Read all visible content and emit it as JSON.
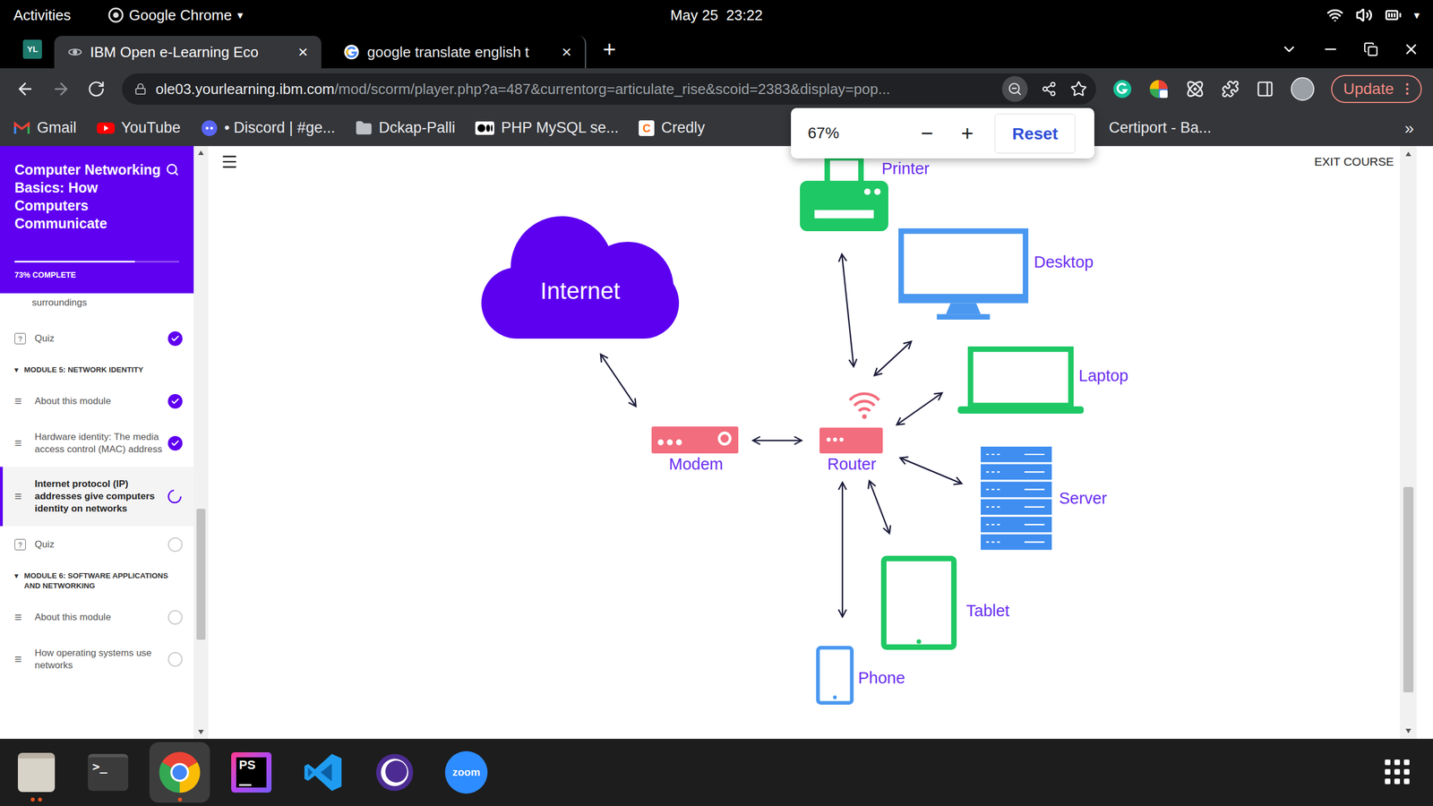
{
  "system_bar": {
    "activities": "Activities",
    "app": "Google Chrome",
    "app_menu": "▾",
    "clock": "May 25  23:22",
    "menu": "▾"
  },
  "tab_strip": {
    "app_icon": "YL",
    "new_tab": "+"
  },
  "tabs": [
    {
      "label": "IBM Open e-Learning Eco",
      "close": "×",
      "selected": true
    },
    {
      "label": "google translate english t",
      "close": "×",
      "selected": false
    }
  ],
  "address_bar": {
    "host": "ole03.yourlearning.ibm.com",
    "path": "/mod/scorm/player.php?a=487&currentorg=articulate_rise&scoid=2383&display=pop...",
    "zoom_active": true
  },
  "update_button": "Update",
  "bookmarks": [
    {
      "label": "Gmail",
      "kind": "gmail"
    },
    {
      "label": "YouTube",
      "kind": "youtube"
    },
    {
      "label": "• Discord | #ge...",
      "kind": "discord"
    },
    {
      "label": "Dckap-Palli",
      "kind": "folder"
    },
    {
      "label": "PHP MySQL se...",
      "kind": "medium"
    },
    {
      "label": "Credly",
      "kind": "credly",
      "icon_text": "C"
    }
  ],
  "bookmarks_right": [
    {
      "label": "Certiport - Ba...",
      "kind": "none"
    }
  ],
  "bookmarks_more": "»",
  "zoom_popup": {
    "level": "67%",
    "minus": "−",
    "plus": "+",
    "reset": "Reset"
  },
  "sidebar": {
    "title": "Computer Networking Basics: How Computers Communicate",
    "progress": {
      "level": 0.73,
      "label": "73% COMPLETE"
    },
    "items": [
      {
        "kind": "partial",
        "label": "surroundings"
      },
      {
        "kind": "quiz",
        "icon": "?",
        "label": "Quiz",
        "completed": true,
        "selected": false
      },
      {
        "kind": "module",
        "icon": "▾",
        "label": "MODULE 5: NETWORK IDENTITY"
      },
      {
        "kind": "lesson",
        "icon": "≡",
        "label": "About this module",
        "completed": true,
        "selected": false
      },
      {
        "kind": "lesson",
        "icon": "≡",
        "label": "Hardware identity: The media access control (MAC) address",
        "completed": true,
        "selected": false
      },
      {
        "kind": "lesson",
        "icon": "≡",
        "label": "Internet protocol (IP) addresses give computers identity on networks",
        "completed": false,
        "selected": true
      },
      {
        "kind": "quiz",
        "icon": "?",
        "label": "Quiz",
        "completed": false,
        "selected": false
      },
      {
        "kind": "module",
        "icon": "▾",
        "label": "MODULE 6: SOFTWARE APPLICATIONS AND NETWORKING"
      },
      {
        "kind": "lesson",
        "icon": "≡",
        "label": "About this module",
        "completed": false,
        "selected": false
      },
      {
        "kind": "lesson",
        "icon": "≡",
        "label": "How operating systems use networks",
        "completed": false,
        "selected": false
      }
    ]
  },
  "main": {
    "exit": "EXIT COURSE"
  },
  "diagram": {
    "nodes": [
      {
        "label": "Internet",
        "kind": "cloud",
        "color": "#5d00f0"
      },
      {
        "label": "Modem",
        "kind": "modem",
        "color": "#f26d7d"
      },
      {
        "label": "Router",
        "kind": "router",
        "color": "#f26d7d"
      },
      {
        "label": "Printer",
        "kind": "printer",
        "color": "#1ec864"
      },
      {
        "label": "Desktop",
        "kind": "desktop",
        "color": "#4a98f0"
      },
      {
        "label": "Laptop",
        "kind": "laptop",
        "color": "#1ec864"
      },
      {
        "label": "Server",
        "kind": "server",
        "color": "#3f8ef0"
      },
      {
        "label": "Tablet",
        "kind": "tablet",
        "color": "#1ec864"
      },
      {
        "label": "Phone",
        "kind": "phone",
        "color": "#4a98f0"
      }
    ]
  },
  "dock": {
    "apps": [
      {
        "kind": "files",
        "label": "",
        "selected": false,
        "running": 2
      },
      {
        "kind": "terminal",
        "label": ">_",
        "selected": false,
        "running": 0
      },
      {
        "kind": "chrome",
        "label": "",
        "selected": true,
        "running": 1
      },
      {
        "kind": "phpstorm",
        "label": "PS",
        "selected": false,
        "running": 0
      },
      {
        "kind": "vscode",
        "label": "",
        "selected": false,
        "running": 0
      },
      {
        "kind": "circle-app",
        "label": "",
        "selected": false,
        "running": 0
      },
      {
        "kind": "zoom",
        "label": "zoom",
        "selected": false,
        "running": 0
      }
    ]
  }
}
